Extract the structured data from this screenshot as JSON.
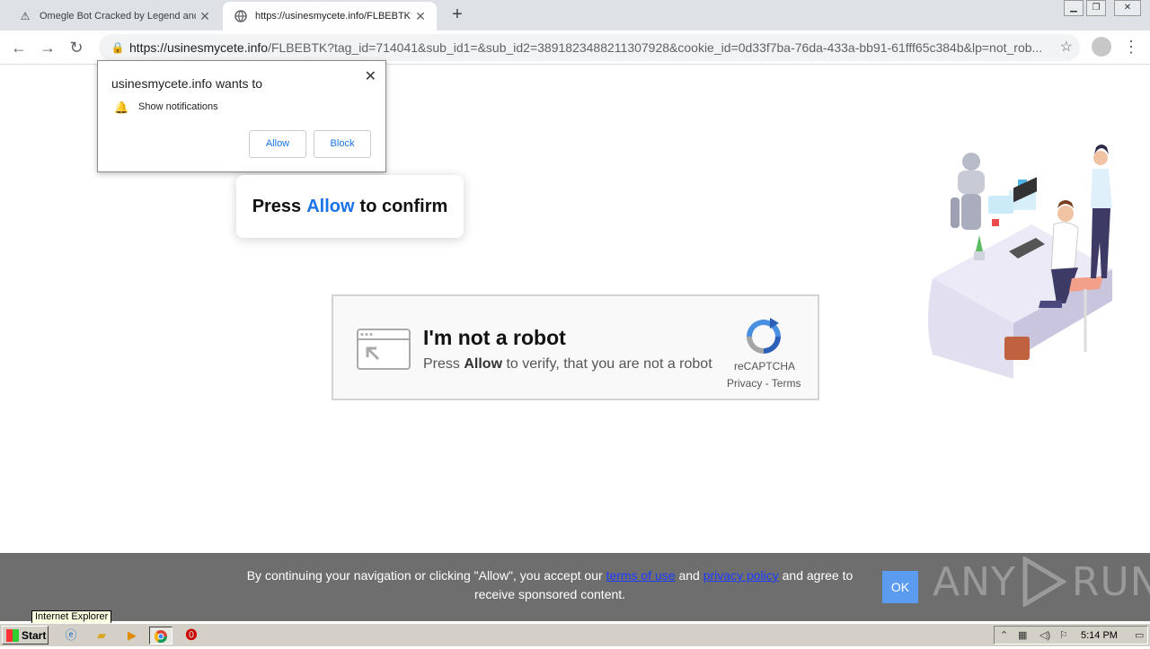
{
  "browser": {
    "tabs": [
      {
        "title": "Omegle Bot Cracked by Legend and",
        "active": false
      },
      {
        "title": "https://usinesmycete.info/FLBEBTK?",
        "active": true
      }
    ],
    "new_tab": "+",
    "url_host": "https://usinesmycete.info",
    "url_path": "/FLBEBTK?tag_id=714041&sub_id1=&sub_id2=3891823488211307928&cookie_id=0d33f7ba-76da-433a-bb91-61fff65c384b&lp=not_rob..."
  },
  "permission_popup": {
    "message": "usinesmycete.info wants to",
    "show_notifications": "Show notifications",
    "allow": "Allow",
    "block": "Block"
  },
  "press_prompt": {
    "before": "Press",
    "allow": "Allow",
    "after": "to confirm"
  },
  "captcha": {
    "heading": "I'm not a robot",
    "sub_before": "Press",
    "sub_bold": "Allow",
    "sub_after": "to verify, that you are not a robot",
    "brand": "reCAPTCHA",
    "links": "Privacy - Terms"
  },
  "cookie_banner": {
    "text_1": "By continuing your navigation or clicking \"Allow\", you accept our",
    "terms_link": "terms of use",
    "text_2": "and",
    "privacy_link": "privacy policy",
    "text_3": "and agree to receive sponsored content.",
    "ok": "OK"
  },
  "watermark": {
    "left": "ANY",
    "right": "RUN"
  },
  "tooltip": "Internet Explorer",
  "taskbar": {
    "start": "Start",
    "time": "5:14 PM"
  }
}
